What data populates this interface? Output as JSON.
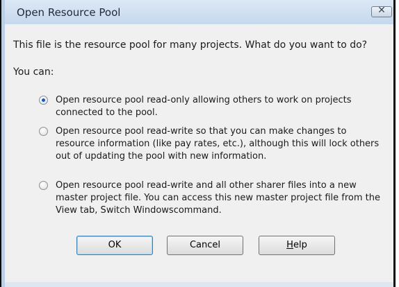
{
  "window": {
    "title": "Open Resource Pool",
    "close_glyph": "✕"
  },
  "message": {
    "question": "This file is the resource pool for many projects. What do you want to do?",
    "you_can": "You can:"
  },
  "options": [
    {
      "label": "Open resource pool read-only allowing others to work on projects connected to the pool.",
      "selected": true
    },
    {
      "label": "Open resource pool read-write so that you can make changes to resource information (like pay rates, etc.), although this will lock others out of updating the pool with new information.",
      "selected": false
    },
    {
      "label": "Open resource pool read-write and all other sharer files into a new master project file.  You can access this new master project file from the View tab, Switch Windowscommand.",
      "selected": false
    }
  ],
  "buttons": {
    "ok": "OK",
    "cancel": "Cancel",
    "help_accel": "H",
    "help_rest": "elp"
  }
}
